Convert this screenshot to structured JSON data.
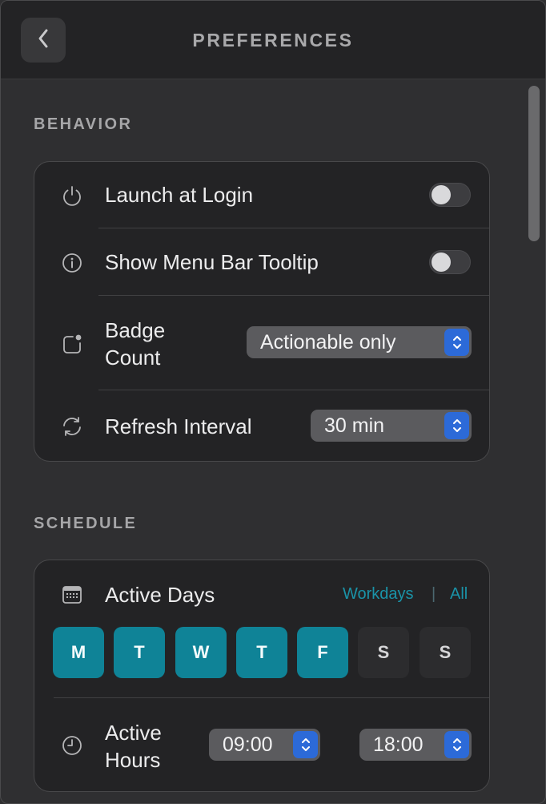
{
  "header": {
    "title": "PREFERENCES",
    "back_icon": "chevron-left-icon"
  },
  "behavior": {
    "label": "BEHAVIOR",
    "launch": {
      "label": "Launch at Login",
      "icon": "power-icon",
      "enabled": false
    },
    "tooltip": {
      "label": "Show Menu Bar Tooltip",
      "icon": "info-icon",
      "enabled": false
    },
    "badge": {
      "label_line1": "Badge",
      "label_line2": "Count",
      "icon": "badge-icon",
      "value": "Actionable only"
    },
    "refresh": {
      "label": "Refresh Interval",
      "icon": "refresh-icon",
      "value": "30 min"
    }
  },
  "schedule": {
    "label": "SCHEDULE",
    "active_days": {
      "label": "Active Days",
      "icon": "calendar-icon",
      "workdays_link": "Workdays",
      "separator": "|",
      "all_link": "All",
      "days": [
        {
          "letter": "M",
          "selected": true
        },
        {
          "letter": "T",
          "selected": true
        },
        {
          "letter": "W",
          "selected": true
        },
        {
          "letter": "T",
          "selected": true
        },
        {
          "letter": "F",
          "selected": true
        },
        {
          "letter": "S",
          "selected": false
        },
        {
          "letter": "S",
          "selected": false
        }
      ]
    },
    "active_hours": {
      "label_line1": "Active",
      "label_line2": "Hours",
      "icon": "clock-icon",
      "start": "09:00",
      "end": "18:00"
    }
  },
  "colors": {
    "accent": "#0f8397",
    "link": "#1a93a8",
    "stepper": "#2c6ad8"
  }
}
